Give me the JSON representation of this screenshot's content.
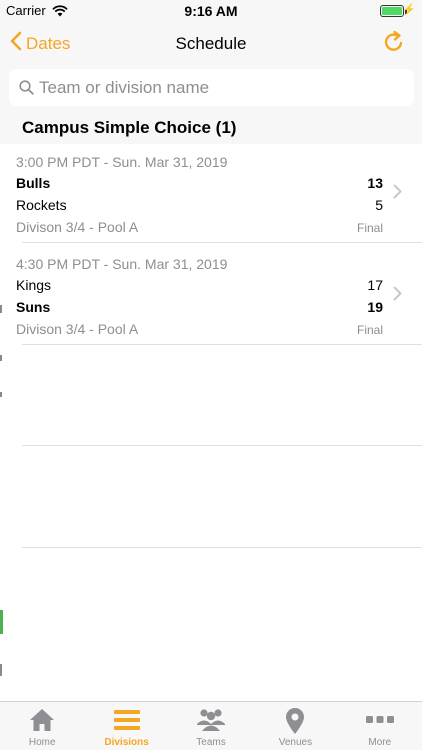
{
  "status_bar": {
    "carrier": "Carrier",
    "time": "9:16 AM",
    "battery_percent": 100
  },
  "nav": {
    "back_label": "Dates",
    "title": "Schedule"
  },
  "search": {
    "placeholder": "Team or division name",
    "value": ""
  },
  "section": {
    "title": "Campus Simple Choice (1)"
  },
  "games": [
    {
      "time": "3:00 PM PDT - Sun. Mar 31, 2019",
      "team1": "Bulls",
      "score1": "13",
      "team1_bold": true,
      "team2": "Rockets",
      "score2": "5",
      "team2_bold": false,
      "division": "Divison 3/4 - Pool A",
      "status": "Final"
    },
    {
      "time": "4:30 PM PDT - Sun. Mar 31, 2019",
      "team1": "Kings",
      "score1": "17",
      "team1_bold": false,
      "team2": "Suns",
      "score2": "19",
      "team2_bold": true,
      "division": "Divison 3/4 - Pool A",
      "status": "Final"
    }
  ],
  "tabs": [
    {
      "label": "Home",
      "icon": "home-icon",
      "active": false
    },
    {
      "label": "Divisions",
      "icon": "list-icon",
      "active": true
    },
    {
      "label": "Teams",
      "icon": "people-icon",
      "active": false
    },
    {
      "label": "Venues",
      "icon": "map-pin-icon",
      "active": false
    },
    {
      "label": "More",
      "icon": "more-icon",
      "active": false
    }
  ],
  "colors": {
    "accent": "#f5a623",
    "inactive": "#8e8e93",
    "bar_background": "#f7f7f7"
  }
}
